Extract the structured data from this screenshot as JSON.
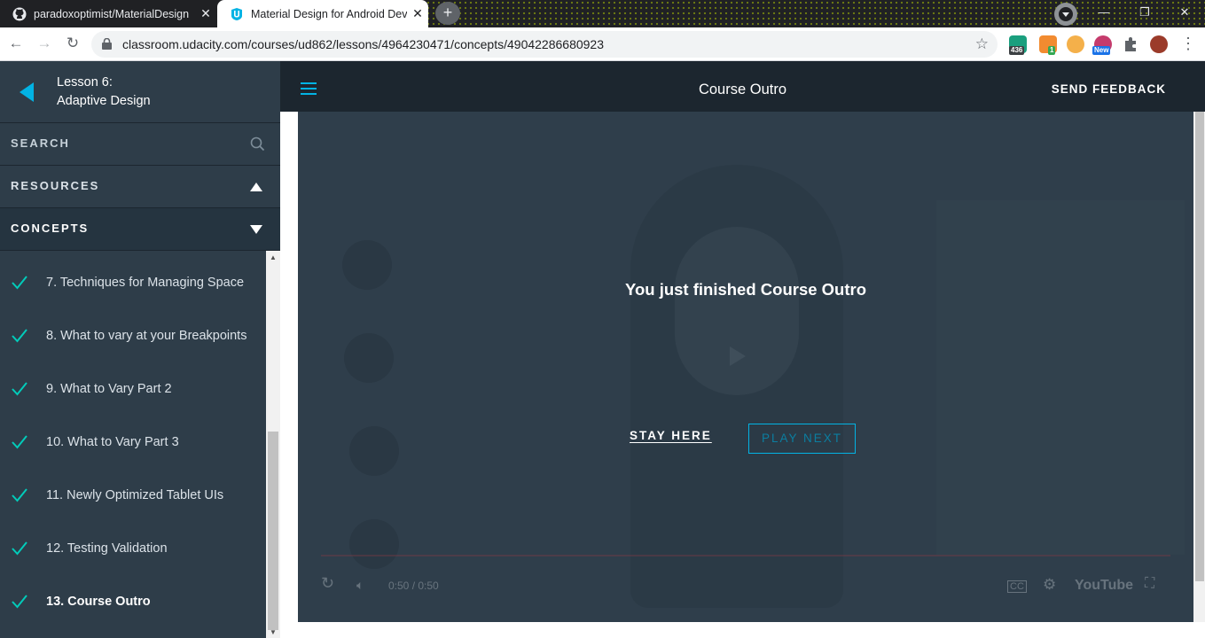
{
  "browser": {
    "tabs": [
      {
        "title": "paradoxoptimist/MaterialDesign",
        "icon": "github-icon",
        "active": false
      },
      {
        "title": "Material Design for Android Dev",
        "icon": "udacity-icon",
        "active": true
      }
    ],
    "new_tab": "+",
    "url": "classroom.udacity.com/courses/ud862/lessons/4964230471/concepts/49042286680923",
    "extensions": [
      {
        "name": "extension-a-icon",
        "badge": "436",
        "color": "#1a9f7e"
      },
      {
        "name": "extension-b-icon",
        "badge": "1",
        "color": "#f28b30"
      },
      {
        "name": "extension-c-icon",
        "badge": "",
        "color": "#f4b04a"
      },
      {
        "name": "extension-d-icon",
        "badge": "New",
        "color": "#5a4fd6"
      },
      {
        "name": "puzzle-icon",
        "badge": "",
        "color": "#5f6368"
      },
      {
        "name": "profile-avatar",
        "badge": "",
        "color": "#9b3b2a"
      }
    ]
  },
  "sidebar": {
    "lesson_number": "Lesson 6:",
    "lesson_title": "Adaptive Design",
    "search_label": "SEARCH",
    "resources_label": "RESOURCES",
    "concepts_label": "CONCEPTS",
    "concepts": [
      {
        "label": "7. Techniques for Managing Space",
        "done": true,
        "current": false
      },
      {
        "label": "8. What to vary at your Breakpoints",
        "done": true,
        "current": false
      },
      {
        "label": "9. What to Vary Part 2",
        "done": true,
        "current": false
      },
      {
        "label": "10. What to Vary Part 3",
        "done": true,
        "current": false
      },
      {
        "label": "11. Newly Optimized Tablet UIs",
        "done": true,
        "current": false
      },
      {
        "label": "12. Testing Validation",
        "done": true,
        "current": false
      },
      {
        "label": "13. Course Outro",
        "done": true,
        "current": true
      }
    ]
  },
  "header": {
    "title": "Course Outro",
    "feedback_label": "SEND FEEDBACK"
  },
  "player": {
    "finished_text": "You just finished Course Outro",
    "stay_label": "STAY HERE",
    "next_label": "PLAY NEXT",
    "time": "0:50 / 0:50",
    "youtube_label": "YouTube"
  },
  "colors": {
    "accent": "#02b3e4",
    "check": "#02ccba",
    "sidebar": "#2e3d49",
    "header": "#1c262f"
  }
}
